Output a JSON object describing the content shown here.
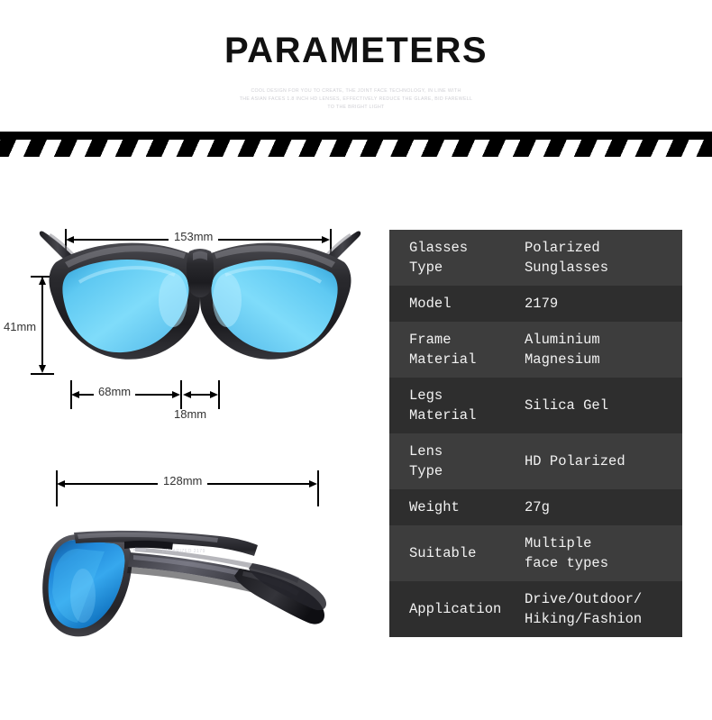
{
  "header": {
    "title": "PARAMETERS",
    "subtitle_lines": [
      "COOL DESIGN FOR YOU TO CREATE, THE JOINT FACE TECHNOLOGY, IN LINE WITH",
      "THE ASIAN FACES 1.8 INCH HD LENSES, EFFECTIVELY REDUCE THE GLARE, BID FAREWELL",
      "TO THE BRIGHT LIGHT"
    ]
  },
  "divider": {
    "icon": "diagonal-stripe-bar",
    "stripe_dark": "#000000",
    "stripe_light": "#ffffff"
  },
  "diagrams": {
    "front_view": {
      "icon": "sunglasses-front-view",
      "lens_color": "#6fd5f5",
      "frame_color": "#2b2b2e",
      "dimensions": {
        "total_width": "153mm",
        "lens_height": "41mm",
        "lens_width": "68mm",
        "bridge_width": "18mm"
      }
    },
    "side_view": {
      "icon": "sunglasses-side-view",
      "lens_color": "#1d7fe0",
      "frame_color": "#3a3a3c",
      "dimensions": {
        "temple_length": "128mm"
      }
    }
  },
  "spec_table": {
    "row_color_odd": "#3d3d3d",
    "row_color_even": "#2e2e2e",
    "text_color": "#f2f2f2",
    "rows": [
      {
        "key": [
          "Glasses",
          "Type"
        ],
        "value": [
          "Polarized",
          "Sunglasses"
        ]
      },
      {
        "key": [
          "Model"
        ],
        "value": [
          "2179"
        ]
      },
      {
        "key": [
          "Frame",
          "Material"
        ],
        "value": [
          "Aluminium",
          "Magnesium"
        ]
      },
      {
        "key": [
          "Legs",
          "Material"
        ],
        "value": [
          "Silica Gel"
        ]
      },
      {
        "key": [
          "Lens",
          "Type"
        ],
        "value": [
          "HD Polarized"
        ]
      },
      {
        "key": [
          "Weight"
        ],
        "value": [
          "27g"
        ]
      },
      {
        "key": [
          "Suitable"
        ],
        "value": [
          "Multiple",
          "face types"
        ]
      },
      {
        "key": [
          "Application"
        ],
        "value": [
          "Drive/Outdoor/",
          "Hiking/Fashion"
        ]
      }
    ]
  }
}
